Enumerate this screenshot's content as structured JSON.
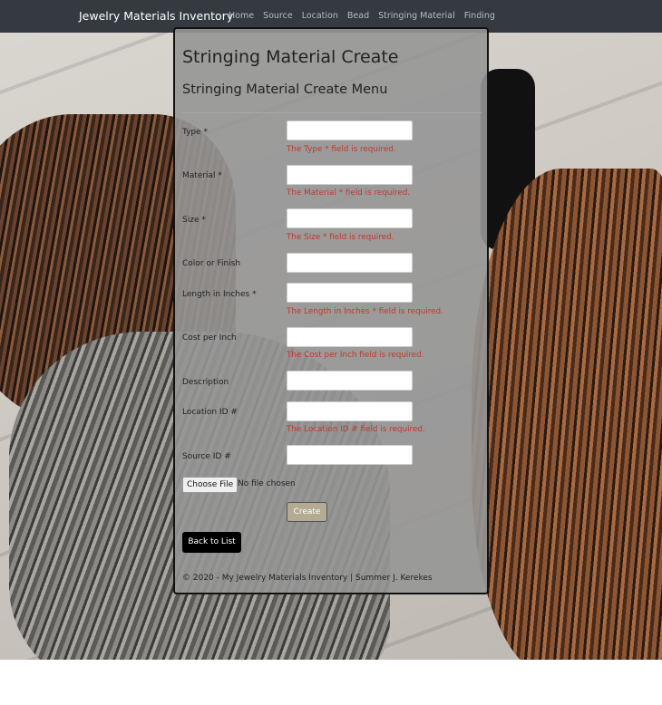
{
  "navbar": {
    "brand": "Jewelry Materials Inventory",
    "links": [
      "Home",
      "Source",
      "Location",
      "Bead",
      "Stringing Material",
      "Finding"
    ]
  },
  "page": {
    "title": "Stringing Material Create",
    "subtitle": "Stringing Material Create Menu"
  },
  "form": {
    "fields": [
      {
        "label": "Type *",
        "value": "",
        "error": "The Type * field is required."
      },
      {
        "label": "Material *",
        "value": "",
        "error": "The Material * field is required."
      },
      {
        "label": "Size *",
        "value": "",
        "error": "The Size * field is required."
      },
      {
        "label": "Color or Finish",
        "value": "",
        "error": ""
      },
      {
        "label": "Length in Inches *",
        "value": "",
        "error": "The Length in Inches * field is required."
      },
      {
        "label": "Cost per Inch",
        "value": "",
        "error": "The Cost per Inch field is required."
      },
      {
        "label": "Description",
        "value": "",
        "error": ""
      },
      {
        "label": "Location ID #",
        "value": "",
        "error": "The Location ID # field is required."
      },
      {
        "label": "Source ID #",
        "value": "",
        "error": ""
      }
    ],
    "file_button": "Choose File",
    "file_status": "No file chosen",
    "create_button": "Create"
  },
  "back_button": "Back to List",
  "footer": "© 2020 - My Jewelry Materials Inventory | Summer J. Kerekes",
  "colors": {
    "navbar_bg": "#343a40",
    "error_text": "#c0392b",
    "create_button_bg": "#b5aa92",
    "back_button_bg": "#000000"
  }
}
